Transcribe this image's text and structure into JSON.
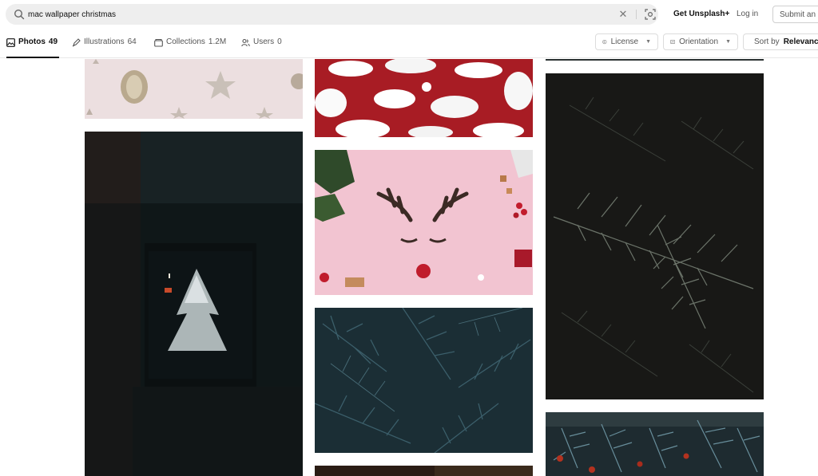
{
  "search": {
    "query": "mac wallpaper christmas",
    "clear_icon": "close-icon",
    "visual_search_icon": "visual-search-icon"
  },
  "header": {
    "get_plus": "Get Unsplash+",
    "login": "Log in",
    "submit": "Submit an image"
  },
  "tabs": [
    {
      "label": "Photos",
      "count": "49",
      "icon": "photo-icon"
    },
    {
      "label": "Illustrations",
      "count": "64",
      "icon": "pen-icon"
    },
    {
      "label": "Collections",
      "count": "1.2M",
      "icon": "collection-icon"
    },
    {
      "label": "Users",
      "count": "0",
      "icon": "users-icon"
    }
  ],
  "filters": {
    "license": "License",
    "orientation": "Orientation",
    "sort_prefix": "Sort by",
    "sort_value": "Relevance"
  },
  "photos": [
    {
      "id": "stars-ornaments",
      "subject": "pink background with paper stars and pine cone"
    },
    {
      "id": "window-tree",
      "subject": "dark window with snowy tree"
    },
    {
      "id": "santa-hats",
      "subject": "red and white santa hat pattern"
    },
    {
      "id": "reindeer",
      "subject": "pink flatlay with reindeer antlers"
    },
    {
      "id": "fir-blue",
      "subject": "dark blue fir branches"
    },
    {
      "id": "fir-dark",
      "subject": "dark fir branch"
    },
    {
      "id": "fir-berries",
      "subject": "fir branches with red berries"
    }
  ],
  "colors": {
    "accent_text": "#111111",
    "muted_text": "#555555",
    "search_bg": "#eeeeee"
  }
}
